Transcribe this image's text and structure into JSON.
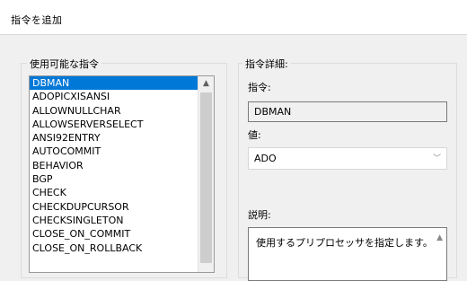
{
  "window": {
    "title": "指令を追加"
  },
  "available": {
    "legend": "使用可能な指令",
    "items": [
      "DBMAN",
      "ADOPICXISANSI",
      "ALLOWNULLCHAR",
      "ALLOWSERVERSELECT",
      "ANSI92ENTRY",
      "AUTOCOMMIT",
      "BEHAVIOR",
      "BGP",
      "CHECK",
      "CHECKDUPCURSOR",
      "CHECKSINGLETON",
      "CLOSE_ON_COMMIT",
      "CLOSE_ON_ROLLBACK"
    ],
    "selected_index": 0
  },
  "details": {
    "legend": "指令詳細:",
    "directive_label": "指令:",
    "directive_value": "DBMAN",
    "value_label": "値:",
    "value_selected": "ADO",
    "description_label": "説明:",
    "description_text": "使用するプリプロセッサを指定します。"
  },
  "colors": {
    "selection": "#0078d7",
    "background": "#f0f0f0"
  }
}
